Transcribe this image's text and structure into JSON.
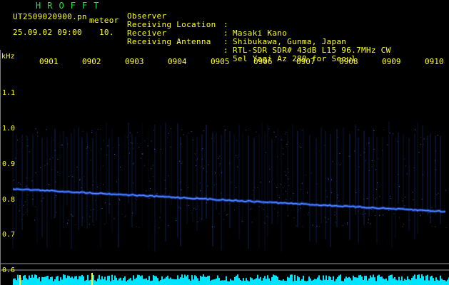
{
  "header": {
    "app_title": "HROFFT",
    "filename": "UT2509020900.pn",
    "meteor_label": "meteor",
    "datetime": "25.09.02 09:00",
    "count": "10.",
    "info": [
      {
        "label": "Observer",
        "value": "Masaki Kano"
      },
      {
        "label": "Receiving Location",
        "value": "Shibukawa, Gunma, Japan"
      },
      {
        "label": "Receiver",
        "value": "RTL-SDR SDR# 43dB L15 96.7MHz CW"
      },
      {
        "label": "Receiving Antenna",
        "value": "5el Yagi Az 280 for Seoul"
      }
    ],
    "colon": ":"
  },
  "axes": {
    "freq_unit": "kHz",
    "time_ticks": [
      "0901",
      "0902",
      "0903",
      "0904",
      "0905",
      "0906",
      "0907",
      "0908",
      "0909",
      "0910"
    ],
    "freq_ticks": [
      "1.1",
      "1.0",
      "0.9",
      "0.8",
      "0.7",
      "0.6"
    ]
  },
  "colors": {
    "text_yellow": "#ffff33",
    "title_green": "#22e04a",
    "signal_blue": "#3a6bff",
    "noise_cyan": "#00e5ff",
    "background": "#000000"
  }
}
